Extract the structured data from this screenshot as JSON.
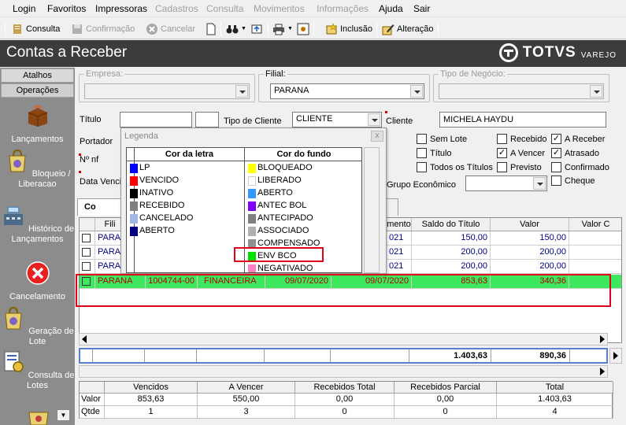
{
  "menu": [
    "Login",
    "Favoritos",
    "Impressoras",
    "Cadastros",
    "Consulta",
    "Movimentos",
    "Informações",
    "Ajuda",
    "Sair"
  ],
  "menu_disabled": [
    false,
    false,
    false,
    true,
    true,
    true,
    true,
    false,
    false
  ],
  "toolbar": {
    "consulta": "Consulta",
    "confirmacao": "Confirmação",
    "cancelar": "Cancelar",
    "inclusao": "Inclusão",
    "alteracao": "Alteração"
  },
  "title": "Contas a Receber",
  "brand": {
    "name": "TOTVS",
    "sub": "VAREJO"
  },
  "sidebar": {
    "tabs": [
      "Atalhos",
      "Operações"
    ],
    "items": [
      {
        "label": "Lançamentos",
        "icon": "box-icon"
      },
      {
        "label": "Bloqueio / Liberacao",
        "icon": "bag-icon"
      },
      {
        "label": "Histórico de Lançamentos",
        "icon": "cash-register-icon"
      },
      {
        "label": "Cancelamento",
        "icon": "cancel-icon"
      },
      {
        "label": "Geração de Lote",
        "icon": "bag-icon"
      },
      {
        "label": "Consulta de Lotes",
        "icon": "document-search-icon"
      }
    ]
  },
  "filters": {
    "empresa_label": "Empresa:",
    "empresa_value": "",
    "filial_label": "Filial:",
    "filial_value": "PARANA",
    "tipo_negocio_label": "Tipo de Negócio:",
    "tipo_negocio_value": "",
    "titulo_label": "Título",
    "portador_label": "Portador",
    "nf_label": "Nº nf",
    "data_venc_label": "Data Venci",
    "tipo_cliente_label": "Tipo de Cliente",
    "tipo_cliente_value": "CLIENTE",
    "cliente_label": "Cliente",
    "cliente_value": "MICHELA HAYDU",
    "grupo_label": "Grupo Econômico",
    "grupo_value": ""
  },
  "checkboxes": [
    {
      "label": "Sem Lote",
      "checked": false
    },
    {
      "label": "Título",
      "checked": false
    },
    {
      "label": "Todos os Títulos",
      "checked": false
    },
    {
      "label": "Recebido",
      "checked": false
    },
    {
      "label": "A Vencer",
      "checked": true
    },
    {
      "label": "Previsto",
      "checked": false
    },
    {
      "label": "A Receber",
      "checked": true
    },
    {
      "label": "Atrasado",
      "checked": true
    },
    {
      "label": "Confirmado",
      "checked": false
    },
    {
      "label": "Cheque",
      "checked": false
    }
  ],
  "tabs": {
    "first": "Co"
  },
  "grid": {
    "headers": [
      "Fili",
      "mento",
      "Saldo do Título",
      "Valor",
      "Valor C"
    ],
    "rows": [
      {
        "filial": "PARAN",
        "venc": "021",
        "saldo": "150,00",
        "valor": "150,00"
      },
      {
        "filial": "PARAN",
        "venc": "021",
        "saldo": "200,00",
        "valor": "200,00"
      },
      {
        "filial": "PARAN",
        "venc": "021",
        "saldo": "200,00",
        "valor": "200,00"
      }
    ],
    "highlight": {
      "filial": "PARANA",
      "numero": "1004744-00",
      "portador": "FINANCEIRA",
      "data1": "09/07/2020",
      "data2": "09/07/2020",
      "saldo": "853,63",
      "valor": "340,36"
    },
    "totals": {
      "saldo": "1.403,63",
      "valor": "890,36"
    }
  },
  "summary": {
    "headers": [
      "Vencidos",
      "A Vencer",
      "Recebidos Total",
      "Recebidos Parcial",
      "Total"
    ],
    "valor_label": "Valor",
    "qtde_label": "Qtde",
    "valor": [
      "853,63",
      "550,00",
      "0,00",
      "0,00",
      "1.403,63"
    ],
    "qtde": [
      "1",
      "3",
      "0",
      "0",
      "4"
    ]
  },
  "legend": {
    "title": "Legenda",
    "close": "x",
    "col_letra": "Cor da letra",
    "col_fundo": "Cor do fundo",
    "letra": [
      {
        "label": "LP",
        "color": "#0000ff"
      },
      {
        "label": "VENCIDO",
        "color": "#ff0000"
      },
      {
        "label": "INATIVO",
        "color": "#000000"
      },
      {
        "label": "RECEBIDO",
        "color": "#808080"
      },
      {
        "label": "CANCELADO",
        "color": "#a0b8e8"
      },
      {
        "label": "ABERTO",
        "color": "#000080"
      }
    ],
    "fundo": [
      {
        "label": "BLOQUEADO",
        "color": "#ffff00"
      },
      {
        "label": "LIBERADO",
        "color": "#ffffff"
      },
      {
        "label": "ABERTO",
        "color": "#3399ff"
      },
      {
        "label": "ANTEC BOL",
        "color": "#8000ff"
      },
      {
        "label": "ANTECIPADO",
        "color": "#808080"
      },
      {
        "label": "ASSOCIADO",
        "color": "#b0b0b0"
      },
      {
        "label": "COMPENSADO",
        "color": "#909090"
      },
      {
        "label": "ENV BCO",
        "color": "#00e000"
      },
      {
        "label": "NEGATIVADO",
        "color": "#ff80c0"
      }
    ]
  }
}
